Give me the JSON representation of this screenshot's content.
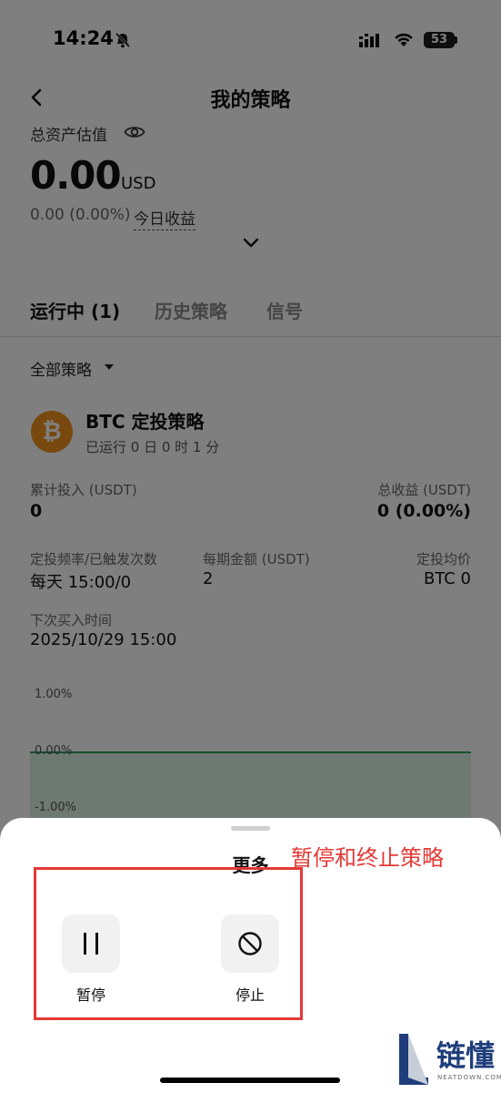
{
  "status_bar": {
    "time": "14:24",
    "battery": "53"
  },
  "header": {
    "title": "我的策略"
  },
  "assets": {
    "label": "总资产估值",
    "value": "0.00",
    "unit": "USD",
    "pnl": "0.00 (0.00%)",
    "pnl_label": "今日收益"
  },
  "tabs": [
    {
      "label": "运行中 (1)"
    },
    {
      "label": "历史策略"
    },
    {
      "label": "信号"
    }
  ],
  "filter": {
    "label": "全部策略"
  },
  "strategy": {
    "name": "BTC 定投策略",
    "logo": "₿",
    "runtime": "已运行 0 日 0 时 1 分",
    "invested_label": "累计投入 (USDT)",
    "invested_value": "0",
    "profit_label": "总收益 (USDT)",
    "profit_value": "0 (0.00%)",
    "frequency_label": "定投频率/已触发次数",
    "frequency_value": "每天 15:00/0",
    "amount_label": "每期金额 (USDT)",
    "amount_value": "2",
    "avg_price_label": "定投均价",
    "avg_price_value": "BTC 0",
    "next_buy_label": "下次买入时间",
    "next_buy_value": "2025/10/29 15:00"
  },
  "chart": {
    "ticks": [
      "1.00%",
      "0.00%",
      "-1.00%"
    ]
  },
  "sheet": {
    "title": "更多",
    "annotation": "暂停和终止策略",
    "actions": [
      {
        "label": "暂停"
      },
      {
        "label": "停止"
      }
    ]
  },
  "watermark": {
    "text": "链懂",
    "sub": "NEATDOWN.COM"
  }
}
